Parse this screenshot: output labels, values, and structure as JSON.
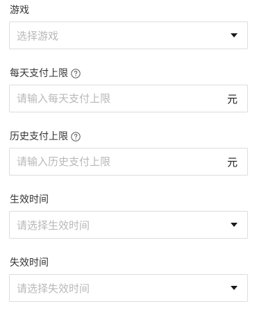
{
  "fields": [
    {
      "label": "游戏",
      "placeholder": "选择游戏",
      "kind": "select"
    },
    {
      "label": "每天支付上限",
      "placeholder": "请输入每天支付上限",
      "unit": "元",
      "kind": "input",
      "help_icon": "question-circle-icon"
    },
    {
      "label": "历史支付上限",
      "placeholder": "请输入历史支付上限",
      "unit": "元",
      "kind": "input",
      "help_icon": "question-circle-icon"
    },
    {
      "label": "生效时间",
      "placeholder": "请选择生效时间",
      "kind": "select"
    },
    {
      "label": "失效时间",
      "placeholder": "请选择失效时间",
      "kind": "select"
    }
  ],
  "colors": {
    "border": "#dcdcdc",
    "placeholder": "#b8b8b8",
    "label": "#333333",
    "caret": "#1a1a1a"
  }
}
